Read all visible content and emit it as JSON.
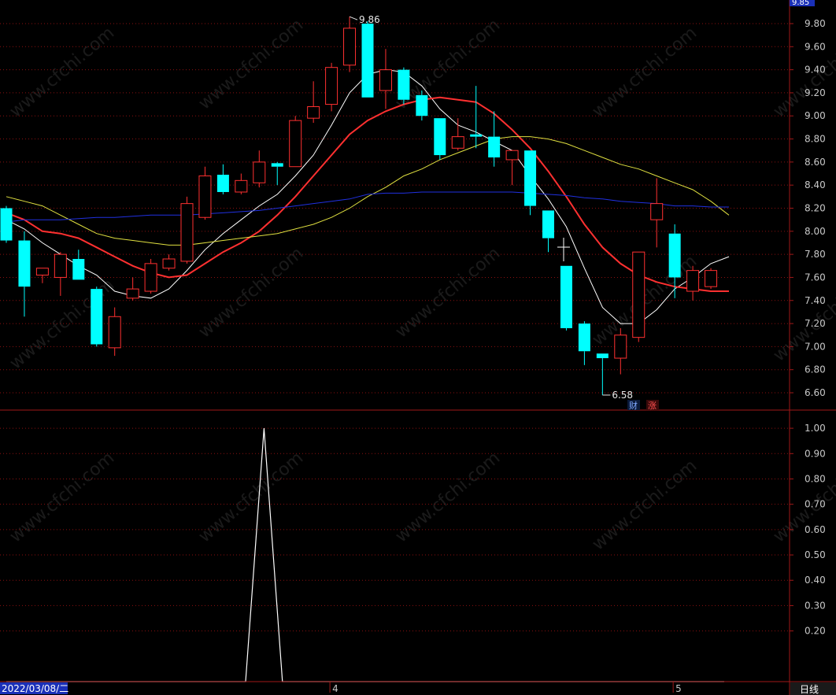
{
  "chart_data": [
    {
      "type": "candlestick",
      "title": "",
      "x": [
        "",
        "",
        "",
        "",
        "",
        "",
        "",
        "",
        "",
        "",
        "",
        "",
        "",
        "",
        "",
        "",
        "",
        "",
        "",
        "",
        "",
        "",
        "",
        "",
        "",
        "",
        "",
        "",
        "",
        "",
        "",
        "",
        "",
        "",
        "",
        "",
        "",
        "",
        ""
      ],
      "x_markers": [
        {
          "index": 0,
          "label": "2022/03/08/二"
        },
        {
          "index": 18,
          "label": "4"
        },
        {
          "index": 37,
          "label": "5"
        }
      ],
      "candles": [
        {
          "open": 8.2,
          "high": 8.22,
          "low": 7.9,
          "close": 7.92
        },
        {
          "open": 7.92,
          "high": 8.0,
          "low": 7.26,
          "close": 7.52
        },
        {
          "open": 7.62,
          "high": 7.68,
          "low": 7.55,
          "close": 7.68
        },
        {
          "open": 7.6,
          "high": 7.82,
          "low": 7.44,
          "close": 7.8
        },
        {
          "open": 7.76,
          "high": 7.84,
          "low": 7.58,
          "close": 7.58
        },
        {
          "open": 7.5,
          "high": 7.52,
          "low": 7.0,
          "close": 7.02
        },
        {
          "open": 6.99,
          "high": 7.34,
          "low": 6.92,
          "close": 7.26
        },
        {
          "open": 7.42,
          "high": 7.6,
          "low": 7.4,
          "close": 7.5
        },
        {
          "open": 7.48,
          "high": 7.76,
          "low": 7.46,
          "close": 7.72
        },
        {
          "open": 7.68,
          "high": 7.8,
          "low": 7.66,
          "close": 7.76
        },
        {
          "open": 7.74,
          "high": 8.3,
          "low": 7.72,
          "close": 8.24
        },
        {
          "open": 8.12,
          "high": 8.56,
          "low": 8.1,
          "close": 8.48
        },
        {
          "open": 8.49,
          "high": 8.58,
          "low": 8.32,
          "close": 8.34
        },
        {
          "open": 8.34,
          "high": 8.5,
          "low": 8.32,
          "close": 8.44
        },
        {
          "open": 8.42,
          "high": 8.7,
          "low": 8.38,
          "close": 8.6
        },
        {
          "open": 8.59,
          "high": 8.6,
          "low": 8.4,
          "close": 8.56
        },
        {
          "open": 8.56,
          "high": 9.0,
          "low": 8.56,
          "close": 8.96
        },
        {
          "open": 8.98,
          "high": 9.3,
          "low": 8.94,
          "close": 9.08
        },
        {
          "open": 9.1,
          "high": 9.46,
          "low": 9.04,
          "close": 9.42
        },
        {
          "open": 9.44,
          "high": 9.86,
          "low": 9.38,
          "close": 9.76
        },
        {
          "open": 9.8,
          "high": 9.82,
          "low": 9.16,
          "close": 9.16
        },
        {
          "open": 9.22,
          "high": 9.58,
          "low": 9.06,
          "close": 9.4
        },
        {
          "open": 9.4,
          "high": 9.42,
          "low": 9.1,
          "close": 9.14
        },
        {
          "open": 9.18,
          "high": 9.22,
          "low": 8.96,
          "close": 9.0
        },
        {
          "open": 8.98,
          "high": 8.98,
          "low": 8.62,
          "close": 8.66
        },
        {
          "open": 8.72,
          "high": 8.98,
          "low": 8.7,
          "close": 8.82
        },
        {
          "open": 8.84,
          "high": 9.26,
          "low": 8.72,
          "close": 8.82
        },
        {
          "open": 8.82,
          "high": 9.04,
          "low": 8.56,
          "close": 8.64
        },
        {
          "open": 8.62,
          "high": 8.7,
          "low": 8.4,
          "close": 8.7
        },
        {
          "open": 8.7,
          "high": 8.7,
          "low": 8.14,
          "close": 8.22
        },
        {
          "open": 8.18,
          "high": 8.18,
          "low": 7.82,
          "close": 7.94
        },
        {
          "open": 7.7,
          "high": 7.7,
          "low": 7.14,
          "close": 7.16
        },
        {
          "open": 7.2,
          "high": 7.22,
          "low": 6.84,
          "close": 6.96
        },
        {
          "open": 6.94,
          "high": 6.94,
          "low": 6.58,
          "close": 6.9
        },
        {
          "open": 6.9,
          "high": 7.16,
          "low": 6.76,
          "close": 7.1
        },
        {
          "open": 7.08,
          "high": 7.82,
          "low": 7.04,
          "close": 7.82
        },
        {
          "open": 8.1,
          "high": 8.46,
          "low": 7.86,
          "close": 8.24
        },
        {
          "open": 7.98,
          "high": 8.06,
          "low": 7.42,
          "close": 7.6
        },
        {
          "open": 7.48,
          "high": 7.7,
          "low": 7.4,
          "close": 7.66
        },
        {
          "open": 7.52,
          "high": 7.68,
          "low": 7.5,
          "close": 7.66
        }
      ],
      "moving_averages": [
        {
          "color": "#ffffff",
          "values": [
            8.1,
            8.02,
            7.9,
            7.8,
            7.7,
            7.62,
            7.48,
            7.44,
            7.42,
            7.5,
            7.66,
            7.84,
            7.98,
            8.1,
            8.22,
            8.32,
            8.48,
            8.66,
            8.92,
            9.2,
            9.36,
            9.4,
            9.38,
            9.26,
            9.06,
            8.92,
            8.86,
            8.78,
            8.7,
            8.48,
            8.28,
            8.04,
            7.68,
            7.34,
            7.2,
            7.2,
            7.32,
            7.5,
            7.6,
            7.72,
            7.78
          ]
        },
        {
          "color": "#ff3030",
          "values": [
            8.16,
            8.1,
            8.0,
            7.98,
            7.94,
            7.86,
            7.78,
            7.7,
            7.64,
            7.6,
            7.62,
            7.72,
            7.82,
            7.9,
            8.0,
            8.14,
            8.3,
            8.48,
            8.66,
            8.84,
            8.96,
            9.04,
            9.1,
            9.14,
            9.16,
            9.14,
            9.12,
            9.02,
            8.88,
            8.72,
            8.52,
            8.3,
            8.06,
            7.86,
            7.72,
            7.62,
            7.56,
            7.52,
            7.5,
            7.48,
            7.48
          ]
        },
        {
          "color": "#e0e040",
          "values": [
            8.3,
            8.26,
            8.22,
            8.14,
            8.06,
            7.98,
            7.94,
            7.92,
            7.9,
            7.88,
            7.88,
            7.9,
            7.92,
            7.94,
            7.96,
            7.98,
            8.02,
            8.06,
            8.12,
            8.2,
            8.3,
            8.38,
            8.48,
            8.54,
            8.62,
            8.68,
            8.74,
            8.8,
            8.82,
            8.82,
            8.8,
            8.76,
            8.7,
            8.64,
            8.58,
            8.54,
            8.48,
            8.42,
            8.36,
            8.26,
            8.14
          ]
        },
        {
          "color": "#2030e0",
          "values": [
            8.08,
            8.1,
            8.1,
            8.1,
            8.11,
            8.12,
            8.12,
            8.13,
            8.14,
            8.14,
            8.14,
            8.15,
            8.16,
            8.17,
            8.18,
            8.2,
            8.22,
            8.24,
            8.26,
            8.28,
            8.32,
            8.33,
            8.33,
            8.34,
            8.34,
            8.34,
            8.34,
            8.34,
            8.34,
            8.33,
            8.32,
            8.31,
            8.29,
            8.28,
            8.26,
            8.25,
            8.24,
            8.22,
            8.22,
            8.21,
            8.21
          ]
        }
      ],
      "ylim": [
        6.45,
        9.95
      ],
      "yticks": [
        "6.60",
        "6.80",
        "7.00",
        "7.20",
        "7.40",
        "7.60",
        "7.80",
        "8.00",
        "8.20",
        "8.40",
        "8.60",
        "8.80",
        "9.00",
        "9.20",
        "9.40",
        "9.60",
        "9.80"
      ],
      "current_price": "9.85",
      "annotations": {
        "high_label": "9.86",
        "high_index": 19,
        "high_value": 9.86,
        "low_label": "6.58",
        "low_index": 33,
        "low_value": 6.58
      },
      "badges": [
        "财",
        "涨"
      ],
      "colors": {
        "up": "#ff3030",
        "down": "#00ffff",
        "grid": "#8b1010",
        "axis": "#a01818"
      }
    },
    {
      "type": "line",
      "title": "",
      "x_count": 40,
      "series": [
        {
          "color": "#ffffff",
          "values": [
            0,
            0,
            0,
            0,
            0,
            0,
            0,
            0,
            0,
            0,
            0,
            0,
            0,
            0,
            1.0,
            0,
            0,
            0,
            0,
            0,
            0,
            0,
            0,
            0,
            0,
            0,
            0,
            0,
            0,
            0,
            0,
            0,
            0,
            0,
            0,
            0,
            0,
            0,
            0,
            0
          ]
        }
      ],
      "ylim": [
        0,
        1.05
      ],
      "yticks": [
        "0.20",
        "0.30",
        "0.40",
        "0.50",
        "0.60",
        "0.70",
        "0.80",
        "0.90",
        "1.00"
      ],
      "colors": {
        "line": "#ffffff",
        "grid": "#8b1010"
      }
    }
  ],
  "footer": {
    "date_label": "2022/03/08/二",
    "period_tab": "日线"
  },
  "watermark": "www.cfchi.com"
}
